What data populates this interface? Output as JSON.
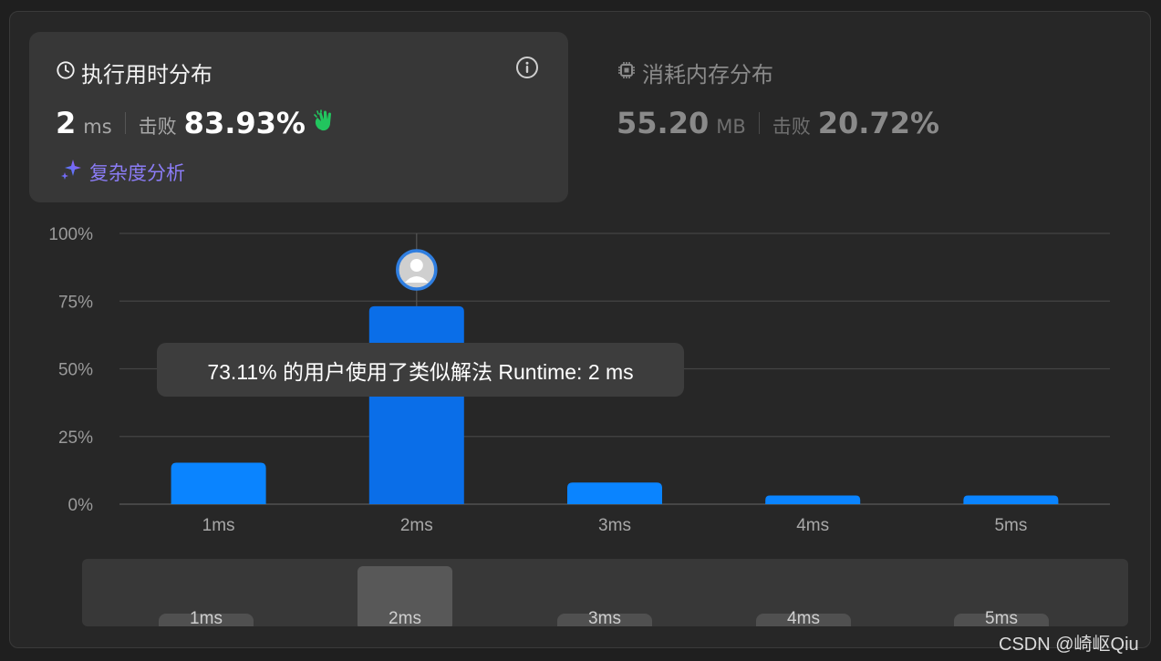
{
  "runtime_card": {
    "title": "执行用时分布",
    "value": "2",
    "unit": "ms",
    "beat_label": "击败",
    "beat_pct": "83.93%",
    "analysis_label": "复杂度分析"
  },
  "memory_card": {
    "title": "消耗内存分布",
    "value": "55.20",
    "unit": "MB",
    "beat_label": "击败",
    "beat_pct": "20.72%"
  },
  "chart_data": {
    "type": "bar",
    "categories": [
      "1ms",
      "2ms",
      "3ms",
      "4ms",
      "5ms"
    ],
    "values": [
      15.3,
      73.11,
      8.0,
      3.2,
      3.2
    ],
    "yticks": [
      "0%",
      "25%",
      "50%",
      "75%",
      "100%"
    ],
    "ylim": [
      0,
      100
    ],
    "highlighted": "2ms",
    "bar_color": "#0a84ff",
    "grid": true
  },
  "tooltip": {
    "text": "73.11% 的用户使用了类似解法 Runtime: 2 ms"
  },
  "brush": {
    "labels": [
      "1ms",
      "2ms",
      "3ms",
      "4ms",
      "5ms"
    ],
    "selected": "2ms"
  },
  "watermark": "CSDN @崎岖Qiu",
  "colors": {
    "accent": "#0a84ff",
    "clap_icon": "#22c55e",
    "analysis_text": "#8b7cf6"
  }
}
